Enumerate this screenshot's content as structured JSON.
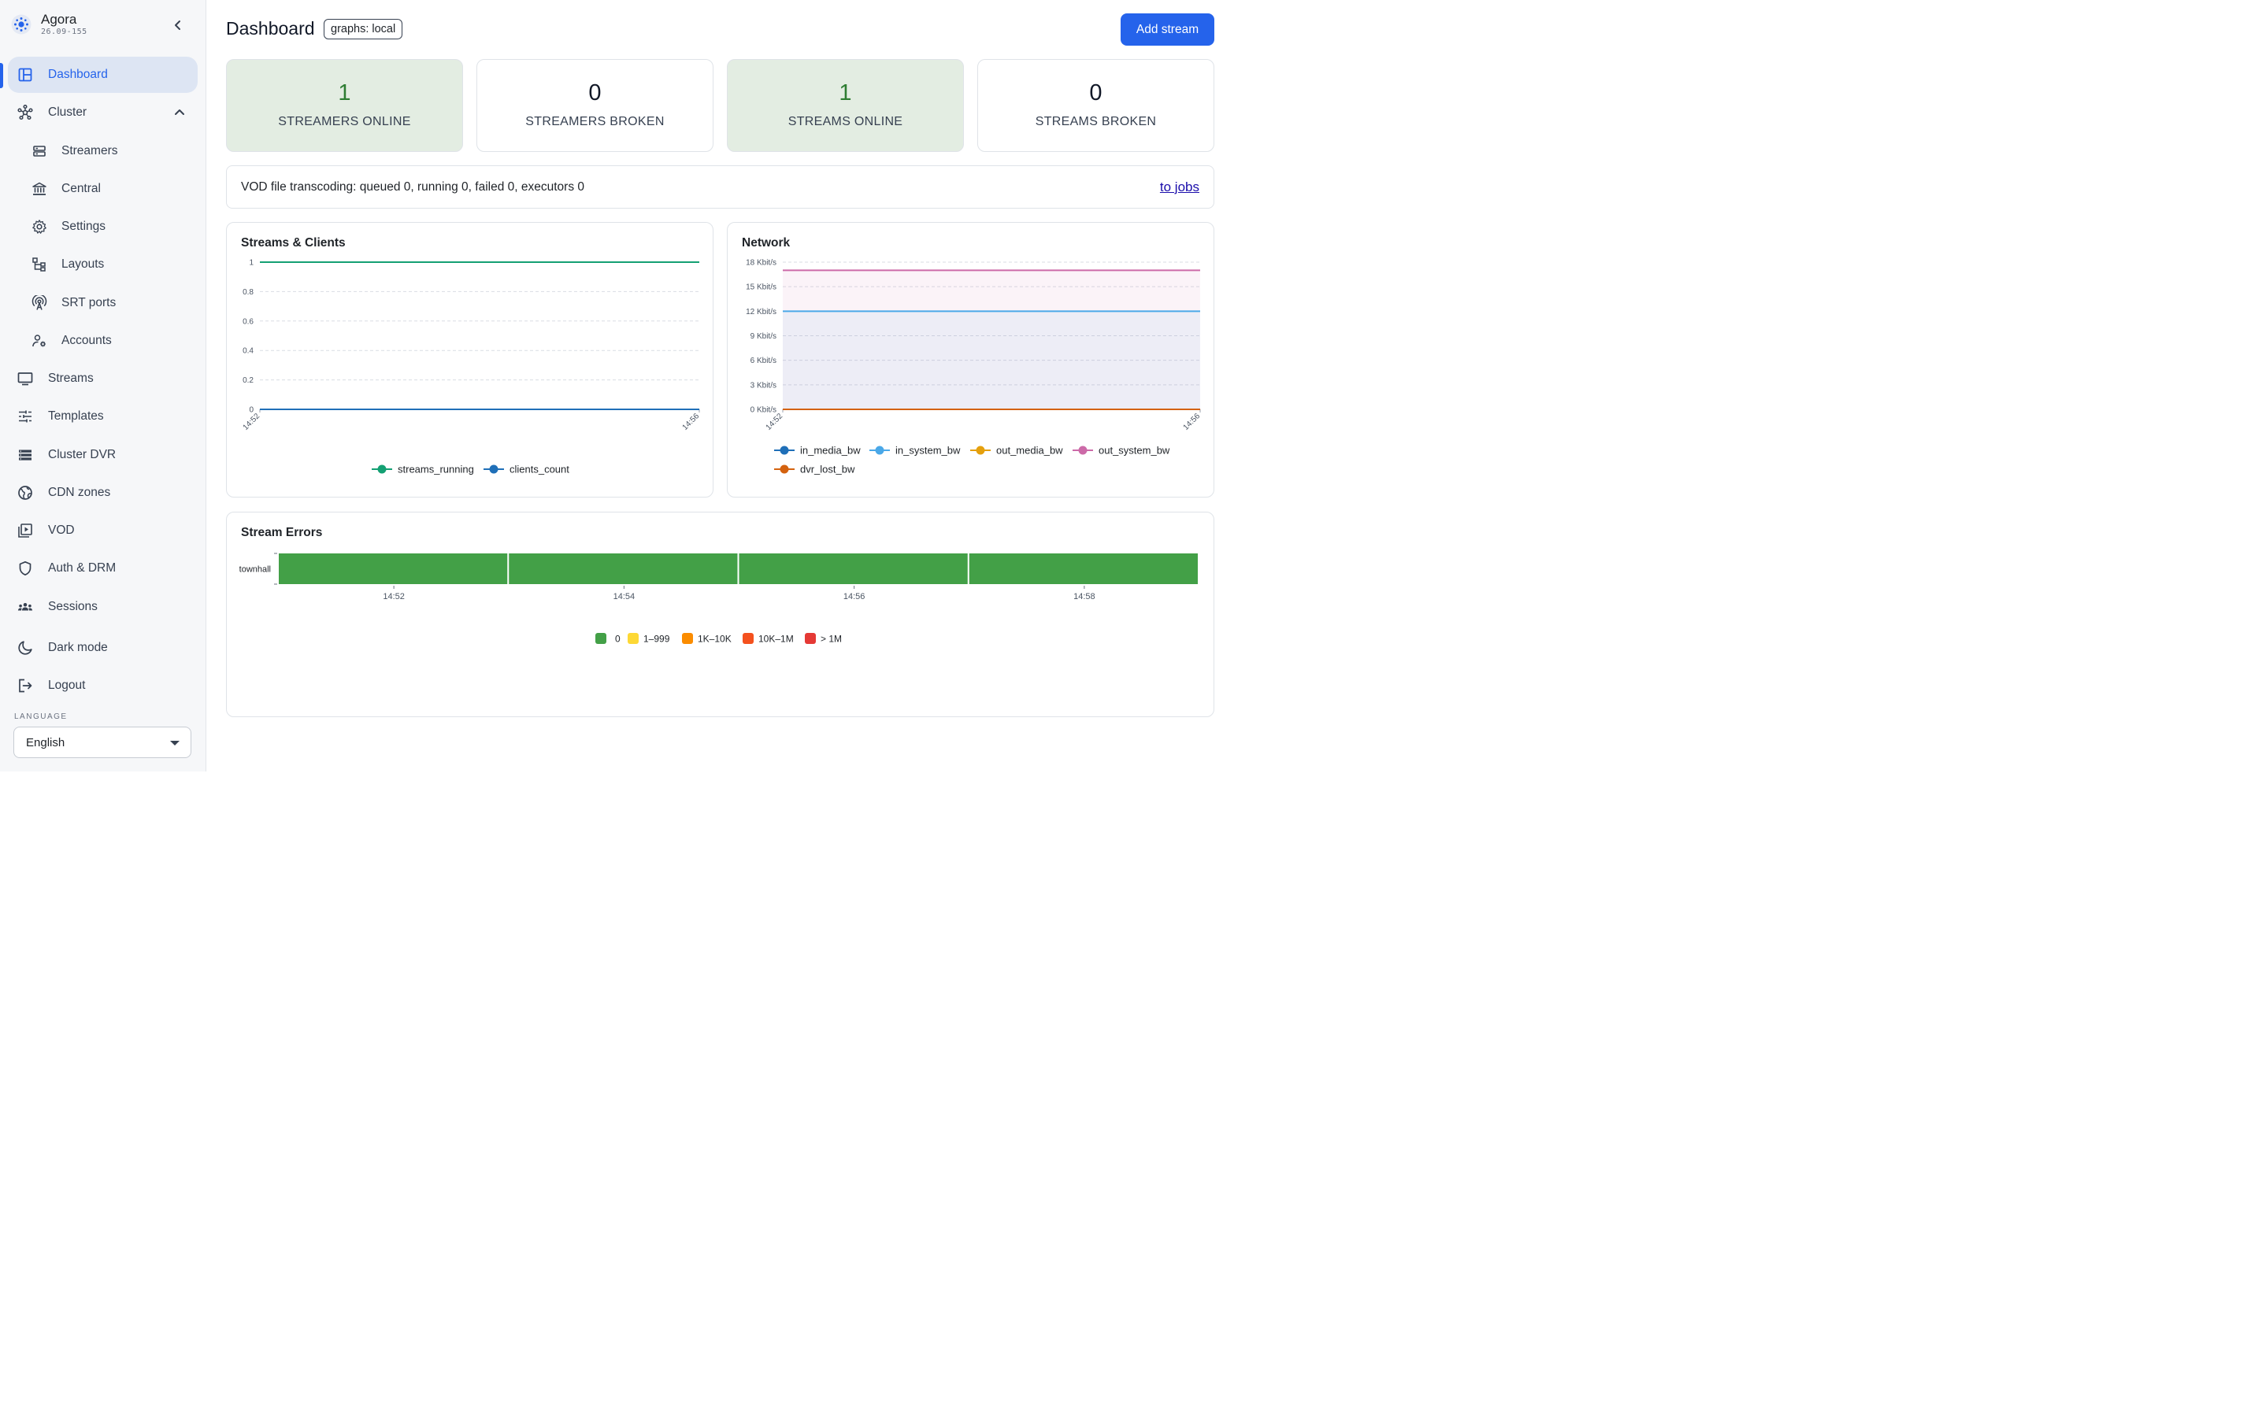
{
  "app": {
    "name": "Agora",
    "version": "26.09-155"
  },
  "sidebar": {
    "items": [
      {
        "label": "Dashboard",
        "icon": "dashboard-icon"
      },
      {
        "label": "Cluster",
        "icon": "cluster-icon"
      },
      {
        "label": "Streamers",
        "icon": "server-icon"
      },
      {
        "label": "Central",
        "icon": "bank-icon"
      },
      {
        "label": "Settings",
        "icon": "gear-icon"
      },
      {
        "label": "Layouts",
        "icon": "layouts-icon"
      },
      {
        "label": "SRT ports",
        "icon": "antenna-icon"
      },
      {
        "label": "Accounts",
        "icon": "accounts-icon"
      },
      {
        "label": "Streams",
        "icon": "monitor-icon"
      },
      {
        "label": "Templates",
        "icon": "sliders-icon"
      },
      {
        "label": "Cluster DVR",
        "icon": "dvr-icon"
      },
      {
        "label": "CDN zones",
        "icon": "globe-icon"
      },
      {
        "label": "VOD",
        "icon": "vod-icon"
      },
      {
        "label": "Auth & DRM",
        "icon": "shield-icon"
      },
      {
        "label": "Sessions",
        "icon": "sessions-icon"
      },
      {
        "label": "Dark mode",
        "icon": "moon-icon"
      },
      {
        "label": "Logout",
        "icon": "logout-icon"
      }
    ],
    "language_label": "LANGUAGE",
    "language_value": "English"
  },
  "header": {
    "title": "Dashboard",
    "graphs_badge": "graphs: local",
    "add_stream": "Add stream"
  },
  "stats": [
    {
      "value": "1",
      "label": "STREAMERS ONLINE"
    },
    {
      "value": "0",
      "label": "STREAMERS BROKEN"
    },
    {
      "value": "1",
      "label": "STREAMS ONLINE"
    },
    {
      "value": "0",
      "label": "STREAMS BROKEN"
    }
  ],
  "vod": {
    "text": "VOD file transcoding: queued 0, running 0, failed 0, executors 0",
    "link": "to jobs"
  },
  "panels": {
    "streams_clients": "Streams & Clients",
    "network": "Network",
    "stream_errors": "Stream Errors"
  },
  "colors": {
    "accent": "#2563eb",
    "ok_bg": "#e3ede2",
    "ok_text": "#2e7d32"
  },
  "chart_data": [
    {
      "type": "line",
      "title": "Streams & Clients",
      "x": [
        "14:52",
        "14:56"
      ],
      "ylim": [
        0,
        1
      ],
      "yticks": [
        "0",
        "0.2",
        "0.4",
        "0.6",
        "0.8",
        "1"
      ],
      "series": [
        {
          "name": "streams_running",
          "values": [
            1,
            1
          ],
          "color": "#14a073"
        },
        {
          "name": "clients_count",
          "values": [
            0,
            0
          ],
          "color": "#1f6fb8"
        }
      ],
      "legend": "bottom",
      "grid": true
    },
    {
      "type": "area",
      "title": "Network",
      "x": [
        "14:52",
        "14:56"
      ],
      "ylim": [
        0,
        18
      ],
      "yticks": [
        "0 Kbit/s",
        "3 Kbit/s",
        "6 Kbit/s",
        "9 Kbit/s",
        "12 Kbit/s",
        "15 Kbit/s",
        "18 Kbit/s"
      ],
      "series": [
        {
          "name": "in_media_bw",
          "values": [
            0,
            0
          ],
          "color": "#1f6fb8"
        },
        {
          "name": "in_system_bw",
          "values": [
            12,
            12
          ],
          "color": "#4aa8e8"
        },
        {
          "name": "out_media_bw",
          "values": [
            0,
            0
          ],
          "color": "#e5a00d"
        },
        {
          "name": "out_system_bw",
          "values": [
            17,
            17
          ],
          "color": "#cc6aa8"
        },
        {
          "name": "dvr_lost_bw",
          "values": [
            0,
            0
          ],
          "color": "#d4620f"
        }
      ],
      "legend": "bottom",
      "grid": true
    },
    {
      "type": "heatmap",
      "title": "Stream Errors",
      "rows": [
        "townhall"
      ],
      "x": [
        "14:52",
        "14:54",
        "14:56",
        "14:58"
      ],
      "cells": [
        [
          0,
          0,
          0,
          0
        ]
      ],
      "legend": [
        {
          "label": "0",
          "color": "#43a047"
        },
        {
          "label": "1–999",
          "color": "#fdd835"
        },
        {
          "label": "1K–10K",
          "color": "#fb8c00"
        },
        {
          "label": "10K–1M",
          "color": "#f4511e"
        },
        {
          "label": "> 1M",
          "color": "#e53935"
        }
      ]
    }
  ]
}
